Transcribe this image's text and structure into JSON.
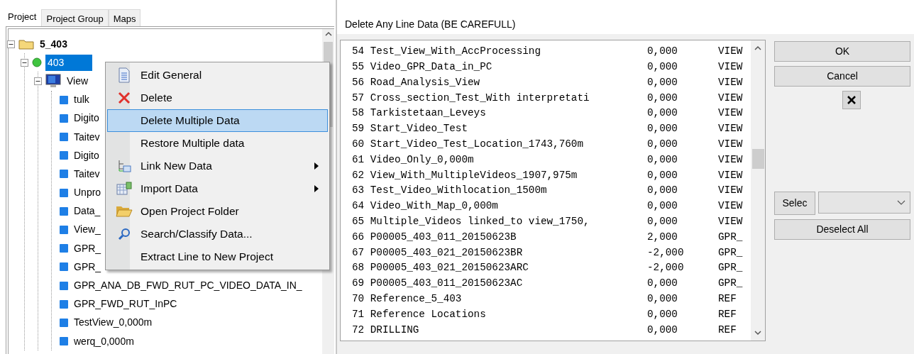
{
  "tabs": [
    {
      "label": "Project",
      "selected": true
    },
    {
      "label": "Project Group",
      "selected": false
    },
    {
      "label": "Maps",
      "selected": false
    }
  ],
  "tree": [
    {
      "label": "5_403",
      "kind": "folder",
      "expanded": true,
      "selected": false,
      "children": [
        {
          "label": "403",
          "kind": "project",
          "expanded": true,
          "selected": true,
          "children": [
            {
              "label": "View",
              "kind": "view",
              "expanded": true,
              "selected": false,
              "children": [
                {
                  "label": "tulk",
                  "kind": "data",
                  "selected": false
                },
                {
                  "label": "Digito",
                  "kind": "data",
                  "selected": false
                },
                {
                  "label": "Taitev",
                  "kind": "data",
                  "selected": false
                },
                {
                  "label": "Digito",
                  "kind": "data",
                  "selected": false
                },
                {
                  "label": "Taitev",
                  "kind": "data",
                  "selected": false
                },
                {
                  "label": "Unpro",
                  "kind": "data",
                  "selected": false
                },
                {
                  "label": "Data_",
                  "kind": "data",
                  "selected": false
                },
                {
                  "label": "View_",
                  "kind": "data",
                  "selected": false
                },
                {
                  "label": "GPR_",
                  "kind": "data",
                  "selected": false
                },
                {
                  "label": "GPR_",
                  "kind": "data",
                  "selected": false
                },
                {
                  "label": "GPR_ANA_DB_FWD_RUT_PC_VIDEO_DATA_IN_",
                  "kind": "data",
                  "selected": false
                },
                {
                  "label": "GPR_FWD_RUT_InPC",
                  "kind": "data",
                  "selected": false
                },
                {
                  "label": "TestView_0,000m",
                  "kind": "data",
                  "selected": false
                },
                {
                  "label": "werq_0,000m",
                  "kind": "data",
                  "selected": false
                }
              ]
            }
          ]
        }
      ]
    }
  ],
  "context_menu": [
    {
      "label": "Edit General",
      "kind": "document",
      "submenu": false,
      "selected": false
    },
    {
      "label": "Delete",
      "kind": "delete",
      "submenu": false,
      "selected": false
    },
    {
      "label": "Delete Multiple Data",
      "kind": "plain",
      "submenu": false,
      "selected": true
    },
    {
      "label": "Restore Multiple data",
      "kind": "plain",
      "submenu": false,
      "selected": false
    },
    {
      "label": "Link New Data",
      "kind": "link",
      "submenu": true,
      "selected": false
    },
    {
      "label": "Import Data",
      "kind": "import",
      "submenu": true,
      "selected": false
    },
    {
      "label": "Open Project Folder",
      "kind": "folder",
      "submenu": false,
      "selected": false
    },
    {
      "label": "Search/Classify Data...",
      "kind": "search",
      "submenu": false,
      "selected": false
    },
    {
      "label": "Extract Line to New Project",
      "kind": "plain",
      "submenu": false,
      "selected": false
    }
  ],
  "dialog": {
    "title": "Delete Any Line Data (BE CAREFULL)",
    "lines": [
      {
        "number": "54",
        "name": "Test_View_With_AccProcessing",
        "value": "0,000",
        "type": "VIEW"
      },
      {
        "number": "55",
        "name": "Video_GPR_Data_in_PC",
        "value": "0,000",
        "type": "VIEW"
      },
      {
        "number": "56",
        "name": "Road_Analysis_View",
        "value": "0,000",
        "type": "VIEW"
      },
      {
        "number": "57",
        "name": "Cross_section_Test_With interpretati",
        "value": "0,000",
        "type": "VIEW"
      },
      {
        "number": "58",
        "name": "Tarkistetaan_Leveys",
        "value": "0,000",
        "type": "VIEW"
      },
      {
        "number": "59",
        "name": "Start_Video_Test",
        "value": "0,000",
        "type": "VIEW"
      },
      {
        "number": "60",
        "name": "Start_Video_Test_Location_1743,760m",
        "value": "0,000",
        "type": "VIEW"
      },
      {
        "number": "61",
        "name": "Video_Only_0,000m",
        "value": "0,000",
        "type": "VIEW"
      },
      {
        "number": "62",
        "name": "View_With_MultipleVideos_1907,975m",
        "value": "0,000",
        "type": "VIEW"
      },
      {
        "number": "63",
        "name": "Test_Video_Withlocation_1500m",
        "value": "0,000",
        "type": "VIEW"
      },
      {
        "number": "64",
        "name": "Video_With_Map_0,000m",
        "value": "0,000",
        "type": "VIEW"
      },
      {
        "number": "65",
        "name": "Multiple_Videos linked_to view_1750,",
        "value": "0,000",
        "type": "VIEW"
      },
      {
        "number": "66",
        "name": "P00005_403_011_20150623B",
        "value": "2,000",
        "type": "GPR_"
      },
      {
        "number": "67",
        "name": "P00005_403_021_20150623BR",
        "value": "-2,000",
        "type": "GPR_"
      },
      {
        "number": "68",
        "name": "P00005_403_021_20150623ARC",
        "value": "-2,000",
        "type": "GPR_"
      },
      {
        "number": "69",
        "name": "P00005_403_011_20150623AC",
        "value": "0,000",
        "type": "GPR_"
      },
      {
        "number": "70",
        "name": "Reference_5_403",
        "value": "0,000",
        "type": "REF"
      },
      {
        "number": "71",
        "name": "Reference Locations",
        "value": "0,000",
        "type": "REF"
      },
      {
        "number": "72",
        "name": "DRILLING",
        "value": "0,000",
        "type": "REF"
      }
    ],
    "ok_button": "OK",
    "cancel_button": "Cancel",
    "select_button": "Selec",
    "deselect_button": "Deselect All"
  }
}
